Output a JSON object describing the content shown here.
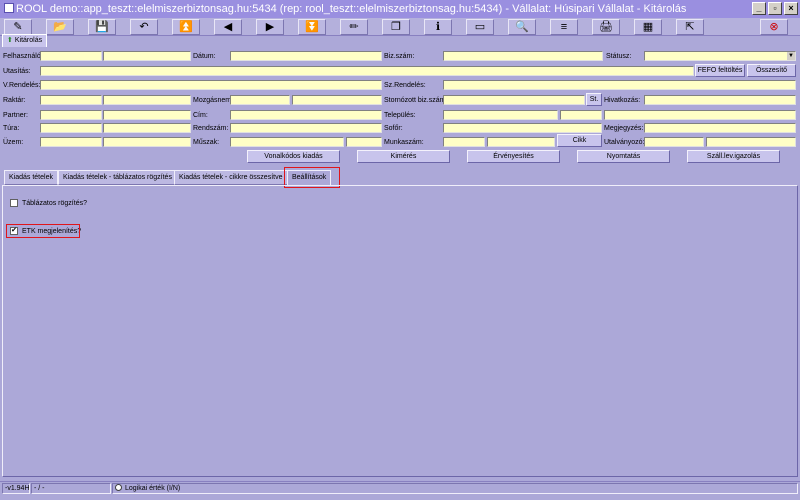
{
  "window": {
    "title": "ROOL demo::app_teszt::elelmiszerbiztonsag.hu:5434 (rep: rool_teszt::elelmiszerbiztonsag.hu:5434) - Vállalat: Húsipari Vállalat - Kitárolás",
    "minimize": "_",
    "restore": "▫",
    "close": "×"
  },
  "toolbar": {
    "icons": [
      "edit-icon",
      "open-icon",
      "save-icon",
      "undo-icon",
      "first-icon",
      "prev-icon",
      "next-icon",
      "last-icon",
      "pencil-icon",
      "copy-icon",
      "info-icon",
      "window-icon",
      "search-icon",
      "list-icon",
      "print-icon",
      "grid-icon",
      "export-icon",
      "exit-icon"
    ],
    "glyphs": [
      "✎",
      "📂",
      "💾",
      "↶",
      "⏫",
      "◀",
      "▶",
      "⏬",
      "✏",
      "❐",
      "ℹ",
      "▭",
      "🔍",
      "≡",
      "🖨",
      "▦",
      "⇱",
      "⊗"
    ]
  },
  "form_tab": {
    "label": "Kitárolás",
    "icon": "tree-icon"
  },
  "labels": {
    "felhasznalo": "Felhasználó:",
    "datum": "Dátum:",
    "biz_szam": "Biz.szám:",
    "statusz": "Státusz:",
    "utasitas": "Utasítás:",
    "v_rendeles": "V.Rendelés:",
    "sz_rendeles": "Sz.Rendelés:",
    "raktar": "Raktár:",
    "mozgasnem": "Mozgásnem:",
    "storno_biz_szam": "Stornózott biz.szám:",
    "hivatkozas": "Hivatkozás:",
    "partner": "Partner:",
    "cim": "Cím:",
    "telepules": "Település:",
    "tura": "Túra:",
    "rendszam": "Rendszám:",
    "sofor": "Sofőr:",
    "megjegyzes": "Megjegyzés:",
    "uzem": "Üzem:",
    "muszak": "Műszak:",
    "munkaszam": "Munkaszám:",
    "utalvanyozo": "Utalványozó:"
  },
  "buttons": {
    "fefo": "FEFO feltöltés",
    "osszesito": "Összesítő",
    "st": "St.",
    "cikk": "Cikk",
    "vonalkodos_kiadas": "Vonalkódos kiadás",
    "kimeres": "Kimérés",
    "ervenyesites": "Érvényesítés",
    "nyomtatas": "Nyomtatás",
    "szall_lev": "Száll.lev.igazolás"
  },
  "tabs": [
    "Kiadás tételek",
    "Kiadás tételek - táblázatos rögzítés",
    "Kiadás tételek - cikkre összesítve",
    "Beállítások"
  ],
  "settings": {
    "tablazatos_label": "Táblázatos rögzítés?",
    "tablazatos_checked": false,
    "etk_label": "ETK megjelenítés?",
    "etk_checked": true,
    "check_mark": "✔"
  },
  "statusbar": {
    "version": "-v1.94H",
    "mode": "- / -",
    "logical": "Logikai érték (I/N)"
  },
  "colors": {
    "background": "#aca8d8",
    "field": "#ffffc6",
    "title_bar": "#9a8fe0",
    "highlight": "#e0151b"
  }
}
